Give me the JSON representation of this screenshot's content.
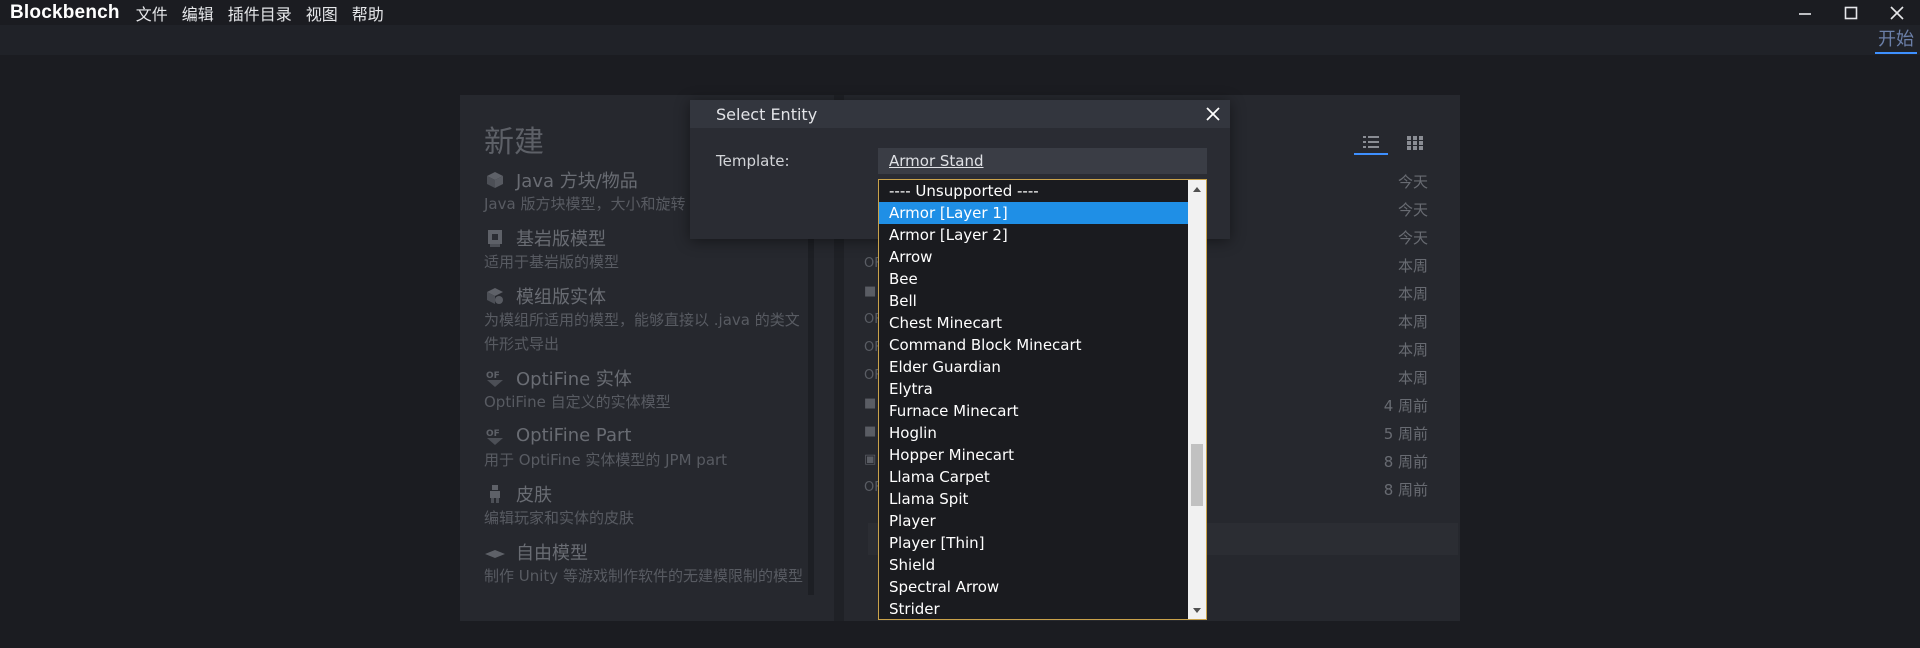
{
  "app": {
    "name": "Blockbench",
    "menu": [
      "文件",
      "编辑",
      "插件目录",
      "视图",
      "帮助"
    ]
  },
  "tab": {
    "label": "开始"
  },
  "start": {
    "new_title": "新建",
    "formats": [
      {
        "name": "Java 方块/物品",
        "desc": "Java 版方块模型，大小和旋转",
        "icon": "java-block-icon"
      },
      {
        "name": "基岩版模型",
        "desc": "适用于基岩版的模型",
        "icon": "bedrock-icon"
      },
      {
        "name": "模组版实体",
        "desc": "为模组所适用的模型，能够直接以 .java 的类文件形式导出",
        "icon": "modded-entity-icon"
      },
      {
        "name": "OptiFine 实体",
        "desc": "OptiFine 自定义的实体模型",
        "icon": "optifine-icon"
      },
      {
        "name": "OptiFine Part",
        "desc": "用于 OptiFine 实体模型的 JPM part",
        "icon": "optifine-part-icon"
      },
      {
        "name": "皮肤",
        "desc": "编辑玩家和实体的皮肤",
        "icon": "skin-icon"
      },
      {
        "name": "自由模型",
        "desc": "制作 Unity 等游戏制作软件的无建模限制的模型",
        "icon": "free-model-icon"
      }
    ],
    "recent_dates": [
      "今天",
      "今天",
      "今天",
      "本周",
      "本周",
      "本周",
      "本周",
      "本周",
      "4 周前",
      "5 周前",
      "8 周前",
      "8 周前"
    ]
  },
  "dialog": {
    "title": "Select Entity",
    "template_label": "Template:",
    "template_value": "Armor Stand"
  },
  "dropdown": {
    "selected_index": 1,
    "scroll_fraction": 0.72,
    "options": [
      "---- Unsupported ----",
      "Armor [Layer 1]",
      "Armor [Layer 2]",
      "Arrow",
      "Bee",
      "Bell",
      "Chest Minecart",
      "Command Block Minecart",
      "Elder Guardian",
      "Elytra",
      "Furnace Minecart",
      "Hoglin",
      "Hopper Minecart",
      "Llama Carpet",
      "Llama Spit",
      "Player",
      "Player [Thin]",
      "Shield",
      "Spectral Arrow",
      "Strider"
    ]
  },
  "colors": {
    "accent": "#1f8fe6",
    "dropdown_border": "#c9a24a",
    "tab_underline": "#3e90ff"
  }
}
